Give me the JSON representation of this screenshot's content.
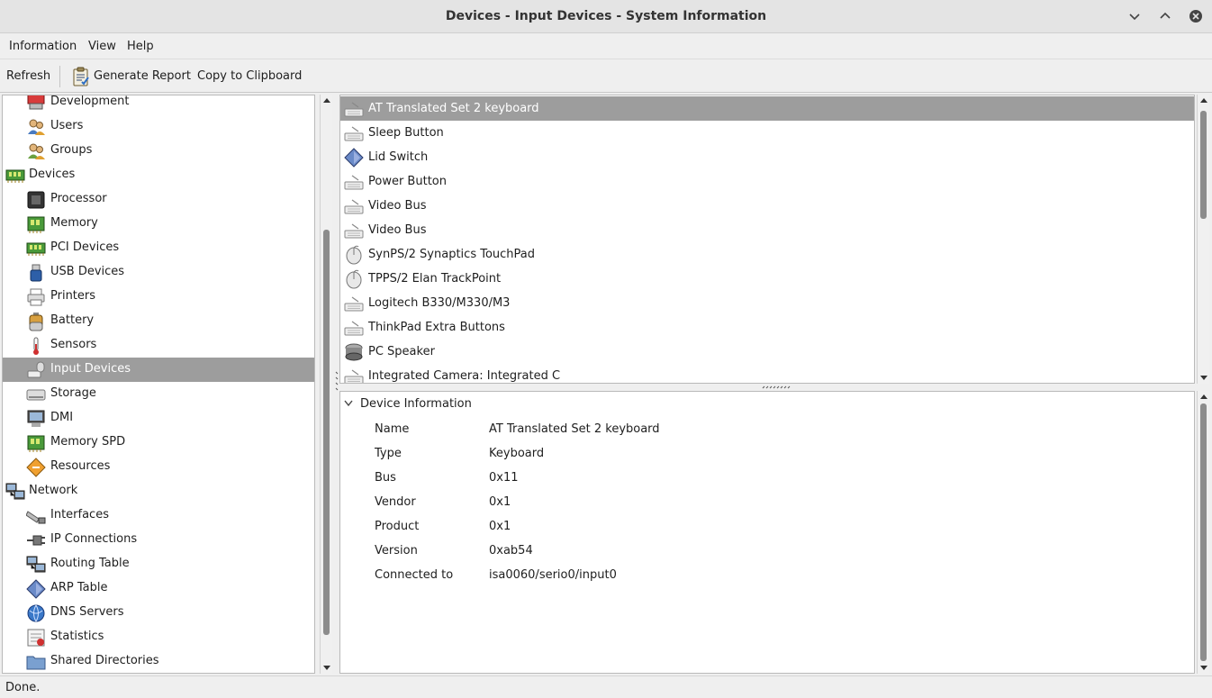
{
  "window": {
    "title": "Devices - Input Devices - System Information"
  },
  "menu": [
    "Information",
    "View",
    "Help"
  ],
  "toolbar": {
    "refresh": "Refresh",
    "generate_report": "Generate Report",
    "copy": "Copy to Clipboard"
  },
  "sidebar": [
    {
      "label": "Development",
      "icon": "development-icon",
      "level": 1
    },
    {
      "label": "Users",
      "icon": "users-icon",
      "level": 1
    },
    {
      "label": "Groups",
      "icon": "groups-icon",
      "level": 1
    },
    {
      "label": "Devices",
      "icon": "devices-icon",
      "level": 0
    },
    {
      "label": "Processor",
      "icon": "processor-icon",
      "level": 1
    },
    {
      "label": "Memory",
      "icon": "memory-icon",
      "level": 1
    },
    {
      "label": "PCI Devices",
      "icon": "pci-icon",
      "level": 1
    },
    {
      "label": "USB Devices",
      "icon": "usb-icon",
      "level": 1
    },
    {
      "label": "Printers",
      "icon": "printer-icon",
      "level": 1
    },
    {
      "label": "Battery",
      "icon": "battery-icon",
      "level": 1
    },
    {
      "label": "Sensors",
      "icon": "thermometer-icon",
      "level": 1
    },
    {
      "label": "Input Devices",
      "icon": "input-devices-icon",
      "level": 1,
      "selected": true
    },
    {
      "label": "Storage",
      "icon": "storage-icon",
      "level": 1
    },
    {
      "label": "DMI",
      "icon": "monitor-icon",
      "level": 1
    },
    {
      "label": "Memory SPD",
      "icon": "memory-icon",
      "level": 1
    },
    {
      "label": "Resources",
      "icon": "resources-icon",
      "level": 1
    },
    {
      "label": "Network",
      "icon": "network-icon",
      "level": 0
    },
    {
      "label": "Interfaces",
      "icon": "interface-icon",
      "level": 1
    },
    {
      "label": "IP Connections",
      "icon": "plug-icon",
      "level": 1
    },
    {
      "label": "Routing Table",
      "icon": "network-icon",
      "level": 1
    },
    {
      "label": "ARP Table",
      "icon": "diamond-icon",
      "level": 1
    },
    {
      "label": "DNS Servers",
      "icon": "globe-icon",
      "level": 1
    },
    {
      "label": "Statistics",
      "icon": "statistics-icon",
      "level": 1
    },
    {
      "label": "Shared Directories",
      "icon": "folder-icon",
      "level": 1
    }
  ],
  "devices": [
    {
      "label": "AT Translated Set 2 keyboard",
      "icon": "keyboard-icon",
      "selected": true
    },
    {
      "label": "Sleep Button",
      "icon": "keyboard-icon"
    },
    {
      "label": "Lid Switch",
      "icon": "diamond-icon"
    },
    {
      "label": "Power Button",
      "icon": "keyboard-icon"
    },
    {
      "label": "Video Bus",
      "icon": "keyboard-icon"
    },
    {
      "label": "Video Bus",
      "icon": "keyboard-icon"
    },
    {
      "label": "SynPS/2 Synaptics TouchPad",
      "icon": "mouse-icon"
    },
    {
      "label": "TPPS/2 Elan TrackPoint",
      "icon": "mouse-icon"
    },
    {
      "label": "Logitech B330/M330/M3",
      "icon": "keyboard-icon"
    },
    {
      "label": "ThinkPad Extra Buttons",
      "icon": "keyboard-icon"
    },
    {
      "label": "PC Speaker",
      "icon": "speaker-icon"
    },
    {
      "label": "Integrated Camera: Integrated C",
      "icon": "keyboard-icon"
    }
  ],
  "details": {
    "section": "Device Information",
    "rows": [
      {
        "key": "Name",
        "value": "AT Translated Set 2 keyboard"
      },
      {
        "key": "Type",
        "value": "Keyboard"
      },
      {
        "key": "Bus",
        "value": "0x11"
      },
      {
        "key": "Vendor",
        "value": "0x1"
      },
      {
        "key": "Product",
        "value": "0x1"
      },
      {
        "key": "Version",
        "value": "0xab54"
      },
      {
        "key": "Connected to",
        "value": "isa0060/serio0/input0"
      }
    ]
  },
  "status": "Done."
}
